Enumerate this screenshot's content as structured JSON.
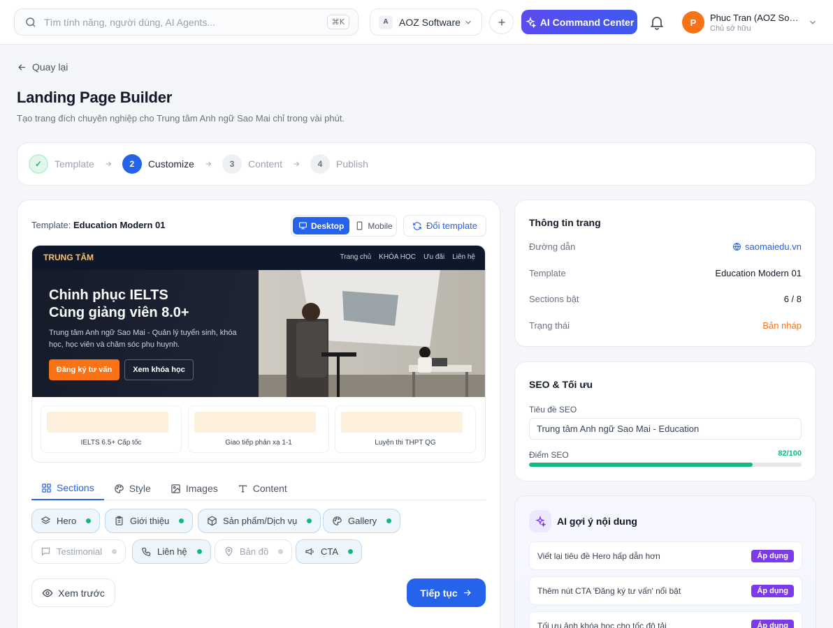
{
  "topbar": {
    "search_placeholder": "Tìm tính năng, người dùng, AI Agents...",
    "search_shortcut": "⌘K",
    "org_badge": "A",
    "org_name": "AOZ Software",
    "ai_button": "AI Command Center",
    "user_initial": "P",
    "user_name": "Phuc Tran (AOZ Software)",
    "user_role": "Chủ sở hữu"
  },
  "header": {
    "back": "Quay lại",
    "title": "Landing Page Builder",
    "subtitle": "Tạo trang đích chuyên nghiệp cho Trung tâm Anh ngữ Sao Mai chỉ trong vài phút."
  },
  "stepper": [
    {
      "num": "✓",
      "label": "Template",
      "state": "done"
    },
    {
      "num": "2",
      "label": "Customize",
      "state": "active"
    },
    {
      "num": "3",
      "label": "Content",
      "state": "todo"
    },
    {
      "num": "4",
      "label": "Publish",
      "state": "todo"
    }
  ],
  "builder": {
    "template_prefix": "Template:",
    "template_name": "Education Modern 01",
    "view_desktop": "Desktop",
    "view_mobile": "Mobile",
    "change_template": "Đổi template"
  },
  "preview": {
    "brand": "TRUNG TÂM",
    "nav": [
      "Trang chủ",
      "KHÓA HỌC",
      "Ưu đãi",
      "Liên hệ"
    ],
    "headline_1": "Chinh phục IELTS",
    "headline_2": "Cùng giảng viên 8.0+",
    "desc": "Trung tâm Anh ngữ Sao Mai - Quản lý tuyển sinh, khóa học, học viên và chăm sóc phụ huynh.",
    "cta_primary": "Đăng ký tư vấn",
    "cta_secondary": "Xem khóa học",
    "cards": [
      "IELTS 6.5+ Cấp tốc",
      "Giao tiếp phản xạ 1-1",
      "Luyện thi THPT QG"
    ]
  },
  "tabs": [
    {
      "label": "Sections",
      "icon": "grid-icon",
      "active": true
    },
    {
      "label": "Style",
      "icon": "palette-icon",
      "active": false
    },
    {
      "label": "Images",
      "icon": "image-icon",
      "active": false
    },
    {
      "label": "Content",
      "icon": "type-icon",
      "active": false
    }
  ],
  "sections": [
    {
      "label": "Hero",
      "icon": "layers-icon",
      "enabled": true
    },
    {
      "label": "Giới thiệu",
      "icon": "clipboard-icon",
      "enabled": true
    },
    {
      "label": "Sản phẩm/Dịch vụ",
      "icon": "box-icon",
      "enabled": true
    },
    {
      "label": "Gallery",
      "icon": "palette-icon",
      "enabled": true
    },
    {
      "label": "Testimonial",
      "icon": "message-icon",
      "enabled": false
    },
    {
      "label": "Liên hệ",
      "icon": "phone-icon",
      "enabled": true
    },
    {
      "label": "Bản đồ",
      "icon": "map-pin-icon",
      "enabled": false
    },
    {
      "label": "CTA",
      "icon": "megaphone-icon",
      "enabled": true
    }
  ],
  "actions": {
    "preview": "Xem trước",
    "next": "Tiếp tục"
  },
  "page_info": {
    "title": "Thông tin trang",
    "rows": [
      {
        "label": "Đường dẫn",
        "value": "saomaiedu.vn"
      },
      {
        "label": "Template",
        "value": "Education Modern 01"
      },
      {
        "label": "Sections bật",
        "value": "6 / 8"
      },
      {
        "label": "Trạng thái",
        "value": "Bản nháp"
      }
    ]
  },
  "seo": {
    "title": "SEO & Tối ưu",
    "field_label": "Tiêu đề SEO",
    "field_value": "Trung tâm Anh ngữ Sao Mai - Education",
    "score_label": "Điểm SEO",
    "score_text": "82/100",
    "score": 82
  },
  "ai_suggest": {
    "title": "AI gợi ý nội dung",
    "apply_label": "Áp dụng",
    "items": [
      "Viết lại tiêu đề Hero hấp dẫn hơn",
      "Thêm nút CTA 'Đăng ký tư vấn' nổi bật",
      "Tối ưu ảnh khóa học cho tốc độ tải"
    ]
  },
  "colors": {
    "primary": "#2563eb",
    "accent_ai": "#7c3aed",
    "success": "#10b981",
    "warning": "#f97316"
  }
}
